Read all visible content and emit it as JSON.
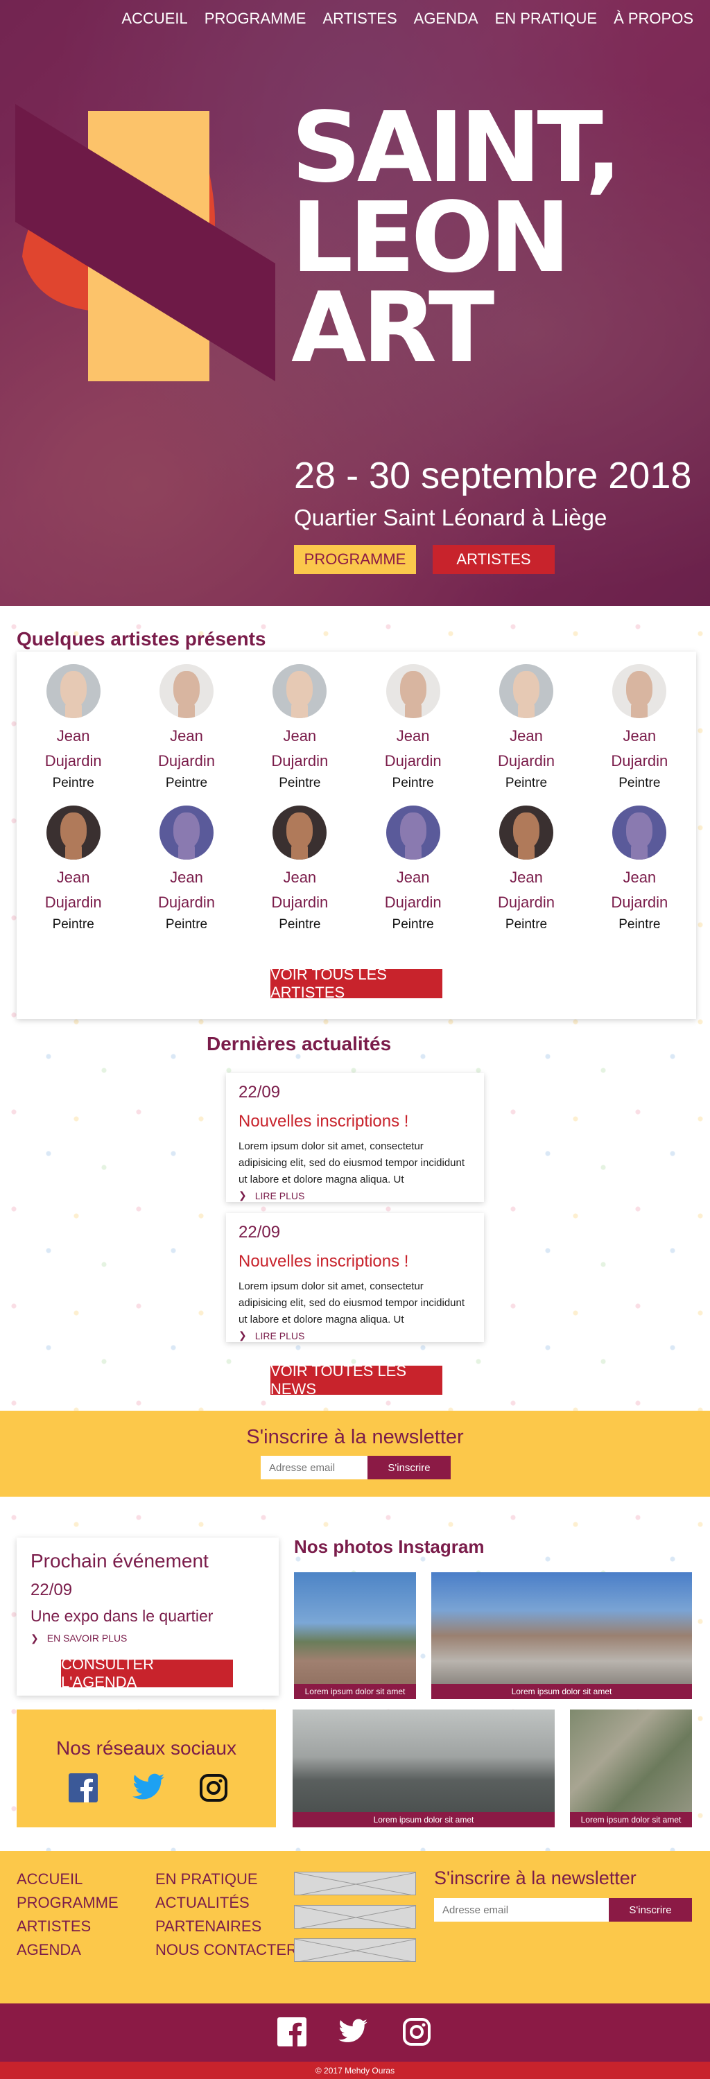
{
  "nav": [
    "ACCUEIL",
    "PROGRAMME",
    "ARTISTES",
    "AGENDA",
    "EN PRATIQUE",
    "À PROPOS"
  ],
  "hero": {
    "title_lines": [
      "SAINT,",
      "LEON",
      "ART"
    ],
    "dates": "28 - 30 septembre 2018",
    "place": "Quartier Saint Léonard à Liège",
    "btn_programme": "PROGRAMME",
    "btn_artistes": "ARTISTES"
  },
  "artists": {
    "heading_hl": "Qu",
    "heading_rest": "elques artistes présents",
    "items": [
      {
        "first": "Jean",
        "last": "Dujardin",
        "role": "Peintre"
      },
      {
        "first": "Jean",
        "last": "Dujardin",
        "role": "Peintre"
      },
      {
        "first": "Jean",
        "last": "Dujardin",
        "role": "Peintre"
      },
      {
        "first": "Jean",
        "last": "Dujardin",
        "role": "Peintre"
      },
      {
        "first": "Jean",
        "last": "Dujardin",
        "role": "Peintre"
      },
      {
        "first": "Jean",
        "last": "Dujardin",
        "role": "Peintre"
      },
      {
        "first": "Jean",
        "last": "Dujardin",
        "role": "Peintre"
      },
      {
        "first": "Jean",
        "last": "Dujardin",
        "role": "Peintre"
      },
      {
        "first": "Jean",
        "last": "Dujardin",
        "role": "Peintre"
      },
      {
        "first": "Jean",
        "last": "Dujardin",
        "role": "Peintre"
      },
      {
        "first": "Jean",
        "last": "Dujardin",
        "role": "Peintre"
      },
      {
        "first": "Jean",
        "last": "Dujardin",
        "role": "Peintre"
      }
    ],
    "button": "VOIR TOUS LES ARTISTES"
  },
  "news": {
    "heading_hl": "Der",
    "heading_rest": "nières actualités",
    "items": [
      {
        "date": "22/09",
        "title": "Nouvelles inscriptions !",
        "text": "Lorem ipsum dolor sit amet, consectetur adipisicing elit, sed do eiusmod tempor incididunt ut labore et dolore magna aliqua. Ut",
        "more": "LIRE PLUS"
      },
      {
        "date": "22/09",
        "title": "Nouvelles inscriptions !",
        "text": "Lorem ipsum dolor sit amet, consectetur adipisicing elit, sed do eiusmod tempor incididunt ut labore et dolore magna aliqua. Ut",
        "more": "LIRE PLUS"
      }
    ],
    "button": "VOIR TOUTES LES NEWS"
  },
  "newsletter": {
    "title": "S'inscrire à la newsletter",
    "placeholder": "Adresse email",
    "button": "S'inscrire"
  },
  "event": {
    "heading_hl": "Pro",
    "heading_rest": "chain événement",
    "date": "22/09",
    "desc": "Une expo dans le quartier",
    "more": "EN SAVOIR PLUS",
    "button": "CONSULTER L'AGENDA"
  },
  "social": {
    "title": "Nos réseaux sociaux",
    "icons": [
      "facebook-icon",
      "twitter-icon",
      "instagram-icon"
    ]
  },
  "instagram": {
    "title": "Nos photos Instagram",
    "captions": [
      "Lorem ipsum dolor sit amet",
      "Lorem ipsum dolor sit amet",
      "Lorem ipsum dolor sit amet",
      "Lorem ipsum dolor sit amet"
    ]
  },
  "footer": {
    "col1": [
      "ACCUEIL",
      "PROGRAMME",
      "ARTISTES",
      "AGENDA"
    ],
    "col2": [
      "EN PRATIQUE",
      "ACTUALITÉS",
      "PARTENAIRES",
      "NOUS CONTACTER"
    ],
    "newsletter_title": "S'inscrire à la newsletter",
    "placeholder": "Adresse email",
    "button": "S'inscrire",
    "copyright": "© 2017 Mehdy Ouras"
  },
  "colors": {
    "brand_purple": "#8b1a45",
    "brand_red": "#c8232c",
    "brand_yellow": "#fcc84a"
  }
}
